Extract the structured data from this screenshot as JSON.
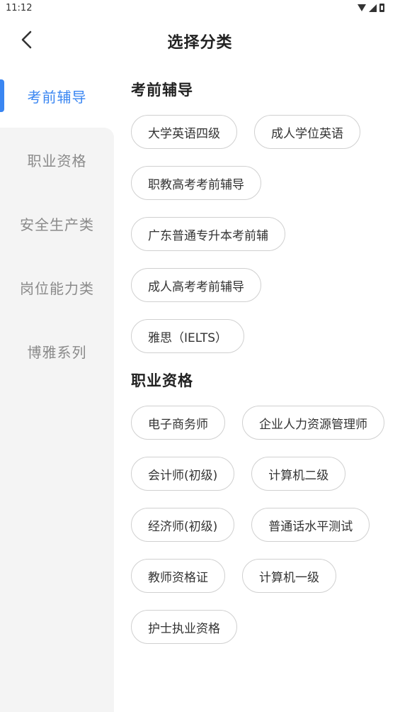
{
  "status_bar": {
    "time": "11:12"
  },
  "header": {
    "title": "选择分类"
  },
  "sidebar": {
    "items": [
      {
        "label": "考前辅导",
        "active": true
      },
      {
        "label": "职业资格",
        "active": false
      },
      {
        "label": "安全生产类",
        "active": false
      },
      {
        "label": "岗位能力类",
        "active": false
      },
      {
        "label": "博雅系列",
        "active": false
      }
    ]
  },
  "sections": [
    {
      "title": "考前辅导",
      "chips": [
        "大学英语四级",
        "成人学位英语",
        "职教高考考前辅导",
        "广东普通专升本考前辅",
        "成人高考考前辅导",
        "雅思（IELTS）"
      ]
    },
    {
      "title": "职业资格",
      "chips": [
        "电子商务师",
        "企业人力资源管理师",
        "会计师(初级)",
        "计算机二级",
        "经济师(初级)",
        "普通话水平测试",
        "教师资格证",
        "计算机一级",
        "护士执业资格"
      ]
    }
  ],
  "colors": {
    "accent": "#3a86f2",
    "sidebar_bg": "#f4f4f4",
    "inactive_text": "#8a8a8a"
  }
}
